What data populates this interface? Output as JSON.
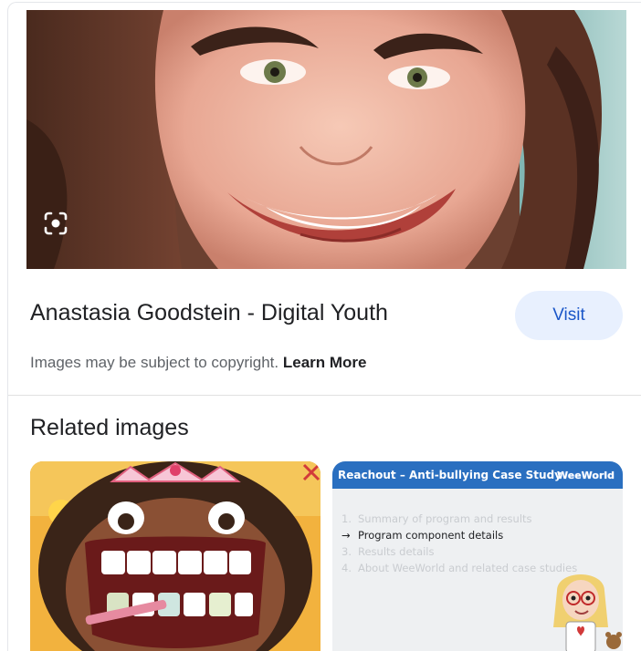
{
  "result": {
    "title": "Anastasia Goodstein - Digital Youth",
    "visit_label": "Visit",
    "copyright_text": "Images may be subject to copyright.",
    "learn_more_label": "Learn More",
    "lens_icon": "google-lens-icon"
  },
  "related": {
    "heading": "Related images",
    "items": [
      {
        "name": "cartoon-dentist-girl",
        "alt": "Cartoon girl with open mouth showing teeth"
      },
      {
        "name": "reachout-slide",
        "slide_title": "Reachout – Anti-bullying Case Study",
        "slide_brand": "WeeWorld",
        "slide_items": [
          {
            "num": "1.",
            "text": "Summary of program and results"
          },
          {
            "num": "→",
            "text": "Program component details"
          },
          {
            "num": "3.",
            "text": "Results details"
          },
          {
            "num": "4.",
            "text": "About WeeWorld and related case studies"
          }
        ]
      }
    ]
  },
  "colors": {
    "visit_bg": "#e8f0fe",
    "visit_text": "#1a56c8",
    "slide_header": "#2a6fc0"
  }
}
